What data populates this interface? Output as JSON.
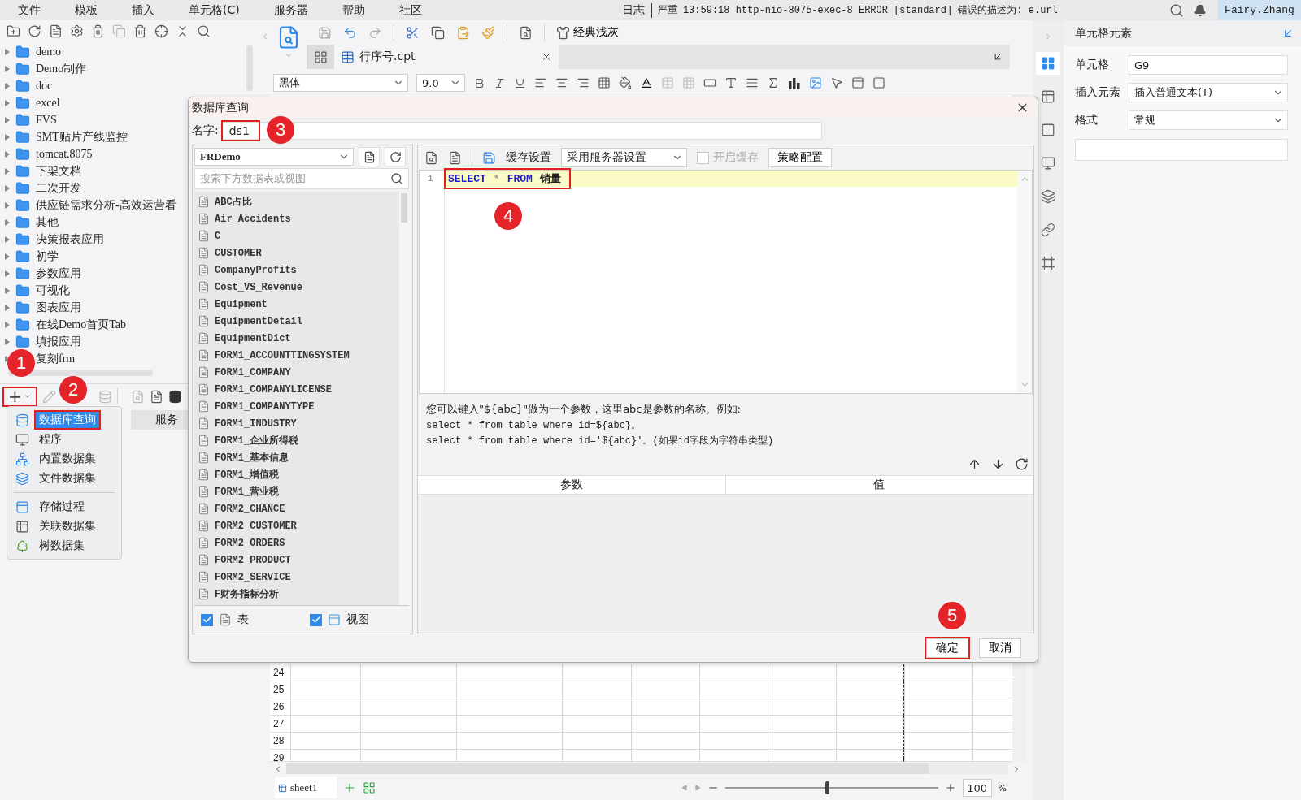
{
  "menu_bar": {
    "items": [
      "文件",
      "模板",
      "插入",
      "单元格(C)",
      "服务器",
      "帮助",
      "社区"
    ],
    "log_label": "日志",
    "log_message": "严重 13:59:18 http-nio-8075-exec-8 ERROR [standard] 错误的描述为: e.url",
    "user": "Fairy.Zhang"
  },
  "template_tree": [
    {
      "label": "demo",
      "expanded": false
    },
    {
      "label": "Demo制作",
      "expanded": false
    },
    {
      "label": "doc",
      "expanded": false
    },
    {
      "label": "excel",
      "expanded": false
    },
    {
      "label": "FVS",
      "expanded": false
    },
    {
      "label": "SMT贴片产线监控",
      "expanded": false
    },
    {
      "label": "tomcat.8075",
      "expanded": false
    },
    {
      "label": "下架文档",
      "expanded": false
    },
    {
      "label": "二次开发",
      "expanded": false
    },
    {
      "label": "供应链需求分析-高效运营看",
      "expanded": false
    },
    {
      "label": "其他",
      "expanded": false
    },
    {
      "label": "决策报表应用",
      "expanded": false
    },
    {
      "label": "初学",
      "expanded": false
    },
    {
      "label": "参数应用",
      "expanded": false
    },
    {
      "label": "可视化",
      "expanded": false
    },
    {
      "label": "图表应用",
      "expanded": false
    },
    {
      "label": "在线Demo首页Tab",
      "expanded": false
    },
    {
      "label": "填报应用",
      "expanded": false
    },
    {
      "label": "复刻frm",
      "expanded": false
    }
  ],
  "dataset_panel": {
    "add_button": {
      "label": "+",
      "highlighted": true
    },
    "tab": "服务",
    "menu": [
      {
        "items": [
          {
            "label": "数据库查询",
            "selected": true,
            "highlighted": true
          },
          {
            "label": "程序",
            "selected": false,
            "highlighted": false
          },
          {
            "label": "内置数据集",
            "selected": false,
            "highlighted": false
          },
          {
            "label": "文件数据集",
            "selected": false,
            "highlighted": false
          }
        ]
      },
      {
        "items": [
          {
            "label": "存储过程",
            "selected": false,
            "highlighted": false
          },
          {
            "label": "关联数据集",
            "selected": false,
            "highlighted": false
          },
          {
            "label": "树数据集",
            "selected": false,
            "highlighted": false
          }
        ]
      }
    ]
  },
  "designer": {
    "theme_button": "经典浅灰",
    "tab": {
      "label": "行序号.cpt"
    },
    "font": "黑体",
    "font_size": "9.0",
    "grid_rows": [
      "24",
      "25",
      "26",
      "27",
      "28",
      "29"
    ],
    "sheet_tab": "sheet1",
    "zoom": {
      "level": 0.48,
      "value": "100",
      "unit": "%"
    }
  },
  "side_tabs": [
    {
      "selected": true
    },
    {
      "selected": false
    },
    {
      "selected": false
    },
    {
      "selected": false
    },
    {
      "selected": false
    },
    {
      "selected": false
    },
    {
      "selected": false
    }
  ],
  "properties": {
    "title": "单元格元素",
    "fields": [
      {
        "label": "单元格",
        "value": "G9",
        "kind": "text"
      },
      {
        "label": "插入元素",
        "value": "插入普通文本(T)",
        "kind": "select"
      },
      {
        "label": "格式",
        "value": "常规",
        "kind": "select"
      }
    ]
  },
  "dialog": {
    "title": "数据库查询",
    "name_label": "名字:",
    "name_value": "ds1",
    "name_highlighted": true,
    "connection": "FRDemo",
    "search_placeholder": "搜索下方数据表或视图",
    "tables": [
      "ABC占比",
      "Air_Accidents",
      "C",
      "CUSTOMER",
      "CompanyProfits",
      "Cost_VS_Revenue",
      "Equipment",
      "EquipmentDetail",
      "EquipmentDict",
      "FORM1_ACCOUNTTINGSYSTEM",
      "FORM1_COMPANY",
      "FORM1_COMPANYLICENSE",
      "FORM1_COMPANYTYPE",
      "FORM1_INDUSTRY",
      "FORM1_企业所得税",
      "FORM1_基本信息",
      "FORM1_增值税",
      "FORM1_营业税",
      "FORM2_CHANCE",
      "FORM2_CUSTOMER",
      "FORM2_ORDERS",
      "FORM2_PRODUCT",
      "FORM2_SERVICE",
      "F财务指标分析"
    ],
    "filters": [
      {
        "label": "表",
        "checked": true,
        "kind": "table"
      },
      {
        "label": "视图",
        "checked": true,
        "kind": "view"
      }
    ],
    "cache": {
      "label": "缓存设置",
      "mode": "采用服务器设置",
      "checkbox": {
        "label": "开启缓存",
        "checked": false,
        "disabled": true
      },
      "button": "策略配置"
    },
    "sql_lines": [
      {
        "number": "1",
        "highlighted": true,
        "tokens": [
          {
            "text": "SELECT",
            "kind": "keyword"
          },
          {
            "text": "*",
            "kind": "operator"
          },
          {
            "text": "FROM",
            "kind": "keyword"
          },
          {
            "text": "销量",
            "kind": "identifier"
          }
        ]
      }
    ],
    "hint_lines": [
      "您可以键入\"${abc}\"做为一个参数，这里abc是参数的名称。例如:",
      "select * from table where id=${abc}。",
      "select * from table where id='${abc}'。(如果id字段为字符串类型)"
    ],
    "param_columns": [
      "参数",
      "值"
    ],
    "buttons": [
      {
        "label": "确定",
        "highlighted": true
      },
      {
        "label": "取消",
        "highlighted": false
      }
    ]
  },
  "annotations": [
    "1",
    "2",
    "3",
    "4",
    "5"
  ]
}
